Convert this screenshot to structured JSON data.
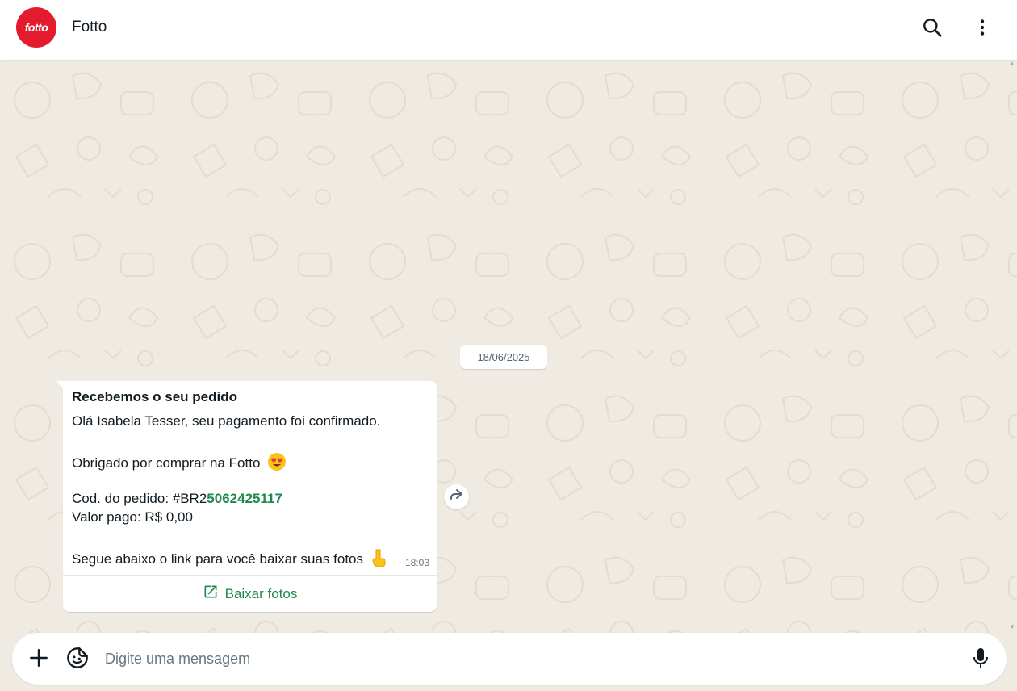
{
  "header": {
    "avatar_text": "fotto",
    "contact_name": "Fotto",
    "icons": [
      "search-icon",
      "more-vertical-icon"
    ]
  },
  "chat": {
    "date_chip": "18/06/2025",
    "message": {
      "title": "Recebemos o seu pedido",
      "line1": "Olá Isabela Tesser, seu pagamento foi confirmado.",
      "line2": "Obrigado por comprar na Fotto",
      "line2_emoji": "heart-eyes-emoji",
      "order_prefix": "Cod. do pedido: #BR2",
      "order_code": "5062425117",
      "amount": "Valor pago: R$ 0,00",
      "line5": "Segue abaixo o link para você baixar suas fotos",
      "line5_emoji": "pointing-down-emoji",
      "time": "18:03",
      "action_label": "Baixar fotos"
    }
  },
  "composer": {
    "placeholder": "Digite uma mensagem",
    "icons": [
      "plus-icon",
      "sticker-icon",
      "microphone-icon"
    ]
  },
  "colors": {
    "brand": "#e31b2d",
    "accent": "#1f8a4c",
    "chat_bg": "#efeae2"
  }
}
